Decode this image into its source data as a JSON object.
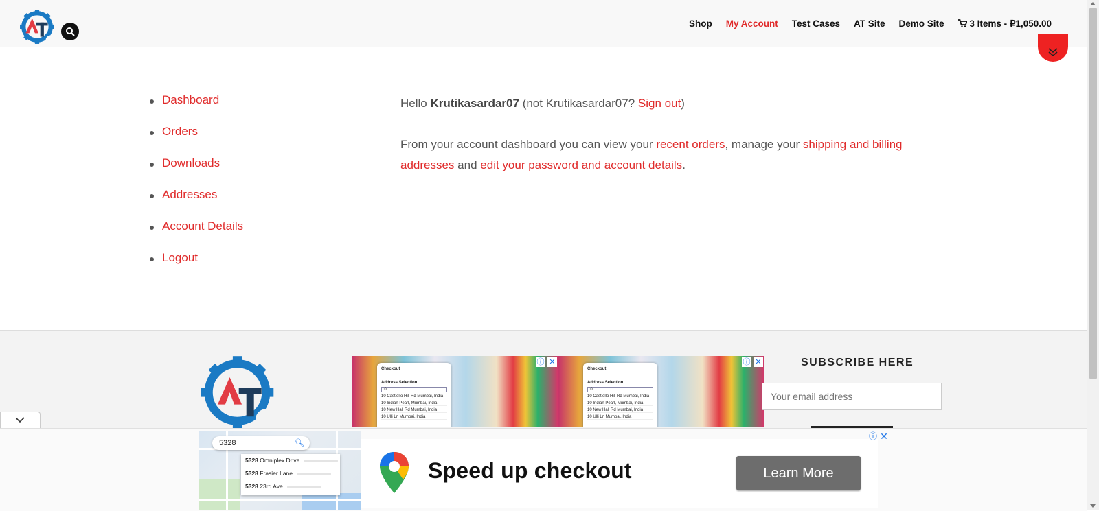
{
  "header": {
    "nav": [
      "Shop",
      "My Account",
      "Test Cases",
      "AT Site",
      "Demo Site"
    ],
    "cart": "3 Items - ₽1,050.00"
  },
  "account_menu": [
    "Dashboard",
    "Orders",
    "Downloads",
    "Addresses",
    "Account Details",
    "Logout"
  ],
  "dashboard": {
    "hello": "Hello",
    "username": "Krutikasardar07",
    "not_user_prefix": "(not Krutikasardar07?",
    "sign_out": "Sign out",
    "close_paren": ")",
    "intro": "From your account dashboard you can view your",
    "recent_orders": "recent orders",
    "manage": ", manage your",
    "addresses_link": "shipping and billing addresses",
    "and": "and",
    "account_link": "edit your password and account details",
    "period": "."
  },
  "footer": {
    "subscribe_title": "SUBSCRIBE HERE",
    "email_placeholder": "Your email address",
    "ad_phone": {
      "title": "Checkout",
      "section": "Address Selection",
      "input": "10",
      "rows": [
        "10 Castlello Hill Rd Mumbai, India",
        "10 Indian Pearl, Mumbai, India",
        "10 New Hall Rd Mumbai, India",
        "10 Ulli Ln Mumbai, India"
      ]
    }
  },
  "bottom_ad": {
    "search_value": "5328",
    "results": [
      {
        "num": "5328",
        "street": "Omniplex Drive"
      },
      {
        "num": "5328",
        "street": "Frasier Lane"
      },
      {
        "num": "5328",
        "street": "23rd Ave"
      }
    ],
    "headline": "Speed up checkout",
    "cta": "Learn More"
  },
  "colors": {
    "accent": "#e02b2b",
    "logo_blue": "#1a7ac4",
    "logo_red": "#e23c44"
  },
  "icons": [
    "search-icon",
    "cart-icon",
    "chevron-down-icon",
    "close-icon",
    "info-icon",
    "map-pin-icon"
  ]
}
